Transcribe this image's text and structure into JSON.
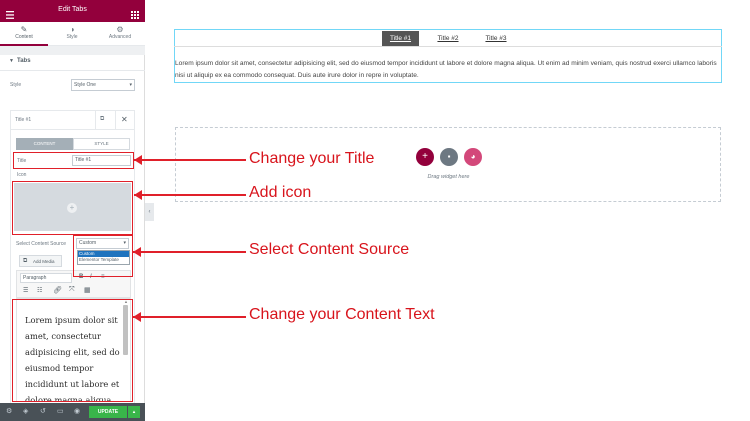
{
  "panel": {
    "title": "Edit Tabs",
    "tabs": [
      {
        "label": "Content",
        "icon": "pencil-icon"
      },
      {
        "label": "Style",
        "icon": "half-circle-icon"
      },
      {
        "label": "Advanced",
        "icon": "gear-icon"
      }
    ],
    "section_title": "Tabs",
    "style_label": "Style",
    "style_value": "Style One",
    "item_title": "Title #1",
    "item_tabs": [
      "CONTENT",
      "STYLE"
    ],
    "title_field_label": "Title",
    "title_field_value": "Title #1",
    "icon_label": "Icon",
    "content_source_label": "Select Content Source",
    "content_source_value": "Custom",
    "content_source_options": [
      "Custom",
      "Elementor Template"
    ],
    "add_media": "Add Media",
    "paragraph_format": "Paragraph",
    "editor_text": "Lorem ipsum dolor sit amet, consectetur adipisicing elit, sed do eiusmod tempor incididunt ut labore et dolore magna aliqua. Ut",
    "update_label": "UPDATE"
  },
  "preview": {
    "tabs": [
      "Title #1",
      "Title #2",
      "Title #3"
    ],
    "body_text": "Lorem ipsum dolor sit amet, consectetur adipisicing elit, sed do eiusmod tempor incididunt ut labore et dolore magna aliqua. Ut enim ad minim veniam, quis nostrud exerci ullamco laboris nisi ut aliquip ex ea commodo consequat. Duis aute irure dolor in repre in voluptate.",
    "drop_hint": "Drag widget here"
  },
  "annotations": {
    "title": "Change your Title",
    "icon": "Add icon",
    "source": "Select Content Source",
    "text": "Change your Content Text"
  },
  "colors": {
    "brand": "#93003c",
    "annotation": "#e0202a",
    "update_green": "#39b54a"
  }
}
